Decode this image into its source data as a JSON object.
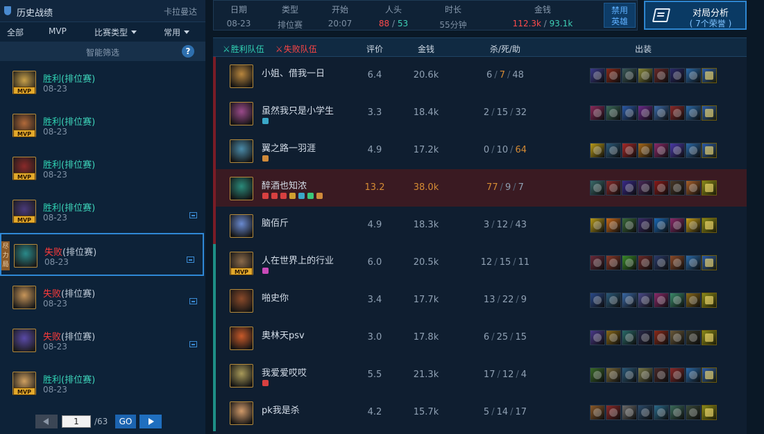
{
  "sidebar": {
    "title": "历史战绩",
    "player_name": "卡拉曼达",
    "filters": {
      "all": "全部",
      "mvp": "MVP",
      "match_type": "比赛类型",
      "common": "常用"
    },
    "smart_filter": "智能筛选",
    "help": "?",
    "matches": [
      {
        "result": "胜利",
        "mode": "(排位赛)",
        "date": "08-23",
        "mvp_label": "MVP",
        "color": "#c9a14a"
      },
      {
        "result": "胜利",
        "mode": "(排位赛)",
        "date": "08-23",
        "mvp_label": "MVP",
        "color": "#b26a3a"
      },
      {
        "result": "胜利",
        "mode": "(排位赛)",
        "date": "08-23",
        "mvp_label": "MVP",
        "color": "#8a2a2a"
      },
      {
        "result": "胜利",
        "mode": "(排位赛)",
        "date": "08-23",
        "mvp_label": "MVP",
        "color": "#4a3a7a"
      },
      {
        "result": "失败",
        "mode": "(排位赛)",
        "date": "08-23",
        "side_tab": "尽力局",
        "color": "#2a8a8a"
      },
      {
        "result": "失败",
        "mode": "(排位赛)",
        "date": "08-23",
        "color": "#c8965a"
      },
      {
        "result": "失败",
        "mode": "(排位赛)",
        "date": "08-23",
        "color": "#5a4aa8"
      },
      {
        "result": "胜利",
        "mode": "(排位赛)",
        "date": "08-23",
        "mvp_label": "MVP",
        "color": "#d0a060"
      }
    ],
    "pager": {
      "current": "1",
      "total": "/63",
      "go": "GO"
    }
  },
  "infobar": {
    "date_label": "日期",
    "date": "08-23",
    "type_label": "类型",
    "type": "排位赛",
    "start_label": "开始",
    "start": "20:07",
    "kills_label": "人头",
    "kills_red": "88",
    "kills_teal": "53",
    "duration_label": "时长",
    "duration": "55分钟",
    "gold_label": "金钱",
    "gold_red": "112.3k",
    "gold_teal": "93.1k",
    "ban_line1": "禁用",
    "ban_line2": "英雄"
  },
  "analysis": {
    "title": "对局分析",
    "subtitle": "( 7个荣誉 )"
  },
  "table": {
    "headers": {
      "win_team": "胜利队伍",
      "loss_team": "失败队伍",
      "score": "评价",
      "gold": "金钱",
      "kda": "杀/死/助",
      "items": "出装"
    },
    "rows": [
      {
        "name": "小姐、借我一日",
        "score": "6.4",
        "gold": "20.6k",
        "k": "6",
        "d": "7",
        "a": "48",
        "hi": "d",
        "team": "loss",
        "avatar": "#b8863e",
        "items": [
          "#3a3a8a",
          "#8a2a1a",
          "#3a5a5a",
          "#8a8a3a",
          "#6a2a2a",
          "#2a2a6a",
          "#2a6aa8"
        ]
      },
      {
        "name": "虽然我只是小学生",
        "score": "3.3",
        "gold": "18.4k",
        "k": "2",
        "d": "15",
        "a": "32",
        "hi": "",
        "team": "loss",
        "avatar": "#9a4a8a",
        "badges": [
          "#3aa8c8"
        ],
        "items": [
          "#8a2a5a",
          "#3a6a5a",
          "#2a5aa8",
          "#6a2a8a",
          "#3a6aa8",
          "#8a2a2a",
          "#2a6aa8"
        ]
      },
      {
        "name": "翼之路一羽涯",
        "score": "4.9",
        "gold": "17.2k",
        "k": "0",
        "d": "10",
        "a": "64",
        "hi": "a",
        "team": "loss",
        "avatar": "#4a8aa8",
        "badges": [
          "#d08a3a"
        ],
        "items": [
          "#b89a1a",
          "#2a5a7a",
          "#a82a2a",
          "#a86a1a",
          "#8a2a6a",
          "#4a3aa8",
          "#2a6aa8"
        ]
      },
      {
        "name": "醉酒也知浓",
        "score": "13.2",
        "gold": "38.0k",
        "k": "77",
        "d": "9",
        "a": "7",
        "hi": "k",
        "team": "loss",
        "highlight": true,
        "avatar": "#2a8a7a",
        "badges": [
          "#d84040",
          "#d84040",
          "#d84040",
          "#d0a030",
          "#3aa8c8",
          "#3ac87a",
          "#d08a3a"
        ],
        "items": [
          "#3a6a6a",
          "#8a2a2a",
          "#3a2a8a",
          "#4a2a5a",
          "#8a1a1a",
          "#4a3a2a",
          "#a8602a"
        ],
        "trinket": "#8a8a1a"
      },
      {
        "name": "脑佰斤",
        "score": "4.9",
        "gold": "18.3k",
        "k": "3",
        "d": "12",
        "a": "43",
        "hi": "",
        "team": "loss",
        "avatar": "#6a8ad0",
        "items": [
          "#b89a1a",
          "#c86a1a",
          "#3a6a3a",
          "#3a2a6a",
          "#1a6ab8",
          "#8a2a6a",
          "#c8a01a"
        ],
        "trinket": "#8a8a1a"
      },
      {
        "name": "人在世界上的行业",
        "score": "6.0",
        "gold": "20.5k",
        "k": "12",
        "d": "15",
        "a": "11",
        "hi": "",
        "team": "win",
        "mvp": "MVP",
        "avatar": "#8a6a4a",
        "badges": [
          "#c84ab8"
        ],
        "items": [
          "#6a2a3a",
          "#8a3a2a",
          "#3a8a2a",
          "#6a2a2a",
          "#2a3a6a",
          "#8a4a2a",
          "#2a6aa8"
        ]
      },
      {
        "name": "啪史你",
        "score": "3.4",
        "gold": "17.7k",
        "k": "13",
        "d": "22",
        "a": "9",
        "hi": "",
        "team": "win",
        "avatar": "#8a4a2a",
        "items": [
          "#2a4a8a",
          "#2a5a7a",
          "#3a6aa8",
          "#4a4a8a",
          "#8a2a6a",
          "#3a8a6a",
          "#8a6a1a"
        ],
        "trinket": "#8a8a1a"
      },
      {
        "name": "奥林天psv",
        "score": "3.0",
        "gold": "17.8k",
        "k": "6",
        "d": "25",
        "a": "15",
        "hi": "",
        "team": "win",
        "avatar": "#c85a2a",
        "items": [
          "#4a3a8a",
          "#8a6a1a",
          "#2a6a6a",
          "#2a2a4a",
          "#8a2a1a",
          "#6a5a3a",
          "#3a3a2a"
        ],
        "trinket": "#8a8a1a"
      },
      {
        "name": "我爱爱哎哎",
        "score": "5.5",
        "gold": "21.3k",
        "k": "17",
        "d": "12",
        "a": "4",
        "hi": "",
        "team": "win",
        "avatar": "#a89a5a",
        "badges": [
          "#d84040"
        ],
        "items": [
          "#3a6a2a",
          "#7a6a3a",
          "#2a5a7a",
          "#7a7a4a",
          "#4a2a2a",
          "#8a2a2a",
          "#2a6aa8"
        ]
      },
      {
        "name": "pk我是杀",
        "score": "4.2",
        "gold": "15.7k",
        "k": "5",
        "d": "14",
        "a": "17",
        "hi": "",
        "team": "win",
        "avatar": "#d09a6a",
        "items": [
          "#8a5a2a",
          "#8a2a2a",
          "#6a6a6a",
          "#2a4a6a",
          "#2a6a8a",
          "#3a6a5a",
          "#3a4a3a"
        ],
        "trinket": "#8a8a1a"
      }
    ]
  },
  "colors": {
    "win": "#2fd3b3",
    "loss": "#ff3b3b",
    "accent": "#2e86d0",
    "highlight_value": "#d58b34"
  }
}
